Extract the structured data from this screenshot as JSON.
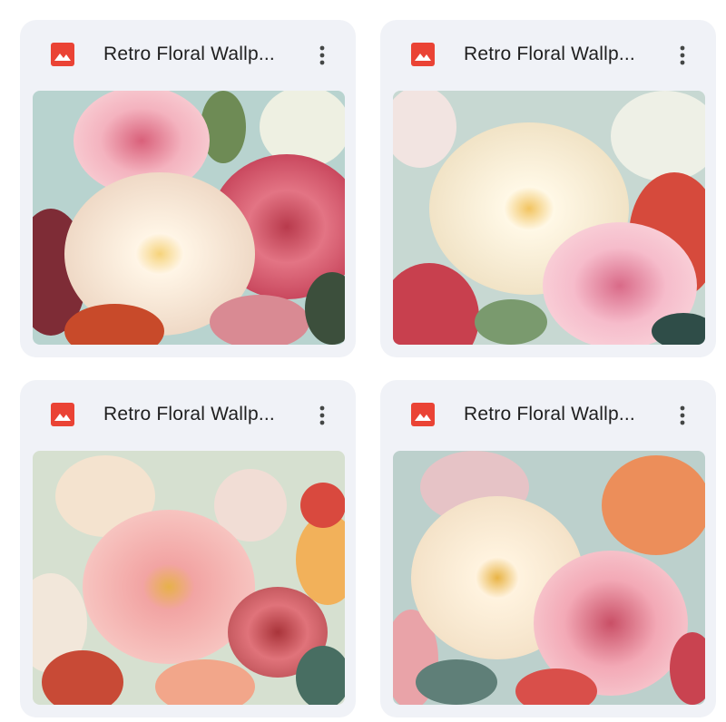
{
  "files": [
    {
      "title": "Retro Floral Wallp...",
      "type": "image",
      "icon": "image-file-icon",
      "menu_icon": "more-vert-icon"
    },
    {
      "title": "Retro Floral Wallp...",
      "type": "image",
      "icon": "image-file-icon",
      "menu_icon": "more-vert-icon"
    },
    {
      "title": "Retro Floral Wallp...",
      "type": "image",
      "icon": "image-file-icon",
      "menu_icon": "more-vert-icon"
    },
    {
      "title": "Retro Floral Wallp...",
      "type": "image",
      "icon": "image-file-icon",
      "menu_icon": "more-vert-icon"
    }
  ],
  "colors": {
    "card_background": "#f0f2f7",
    "image_icon": "#ea4335",
    "title_text": "#1f1f1f",
    "menu_icon": "#444746"
  }
}
